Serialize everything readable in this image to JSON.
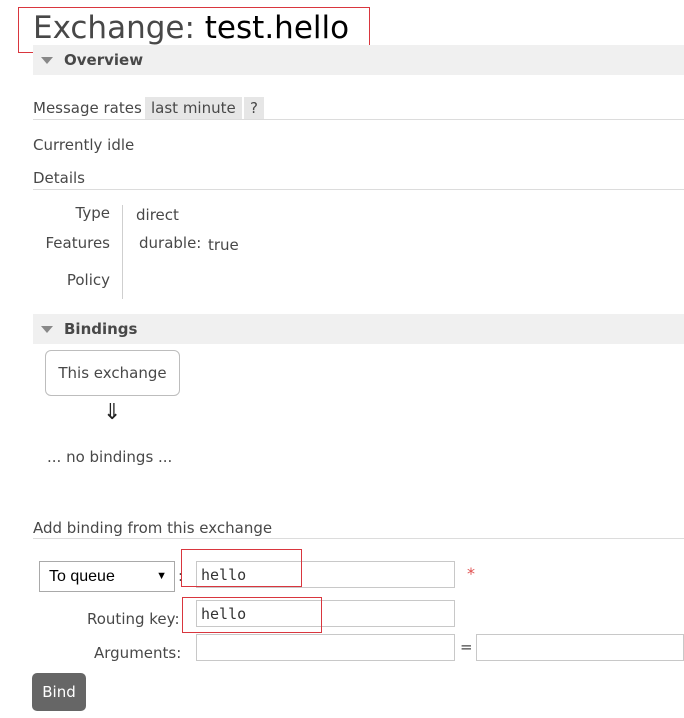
{
  "title": {
    "prefix": "Exchange:",
    "name": "test.hello"
  },
  "overview": {
    "header": "Overview",
    "message_rates_label": "Message rates",
    "rate_period": "last minute",
    "help": "?",
    "idle_text": "Currently idle",
    "details_label": "Details",
    "type_key": "Type",
    "type_value": "direct",
    "features_key": "Features",
    "durable_key": "durable:",
    "durable_value": "true",
    "policy_key": "Policy"
  },
  "bindings": {
    "header": "Bindings",
    "exchange_node": "This exchange",
    "arrow": "⇓",
    "empty_text": "... no bindings ..."
  },
  "add_binding": {
    "title": "Add binding from this exchange",
    "destination_type": "To queue",
    "colon": ":",
    "destination_value": "hello",
    "required_mark": "*",
    "routing_key_label": "Routing key:",
    "routing_key_value": "hello",
    "arguments_label": "Arguments:",
    "arguments_key": "",
    "equals": "=",
    "arguments_value": "",
    "bind_label": "Bind"
  },
  "colors": {
    "highlight_box": "#d9363e",
    "bind_button": "#666666",
    "section_header": "#f0f0f0"
  }
}
